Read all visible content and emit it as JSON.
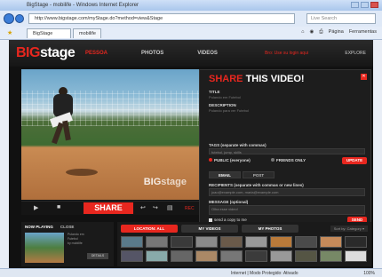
{
  "browser": {
    "title": "BigStage - mobilife - Windows Internet Explorer",
    "address": "http://www.bigstage.com/myStage.do?method=view&Stage",
    "search_placeholder": "Live Search",
    "tabs": [
      "BigStage",
      "mobilife"
    ],
    "tools": [
      "Página",
      "Ferramentas"
    ],
    "status_zone": "Internet | Modo Protegido: Ativado",
    "zoom": "100%"
  },
  "site": {
    "logo_big": "BIG",
    "logo_stage": "stage",
    "nav": [
      "PESSOA",
      "PHOTOS",
      "VIDEOS"
    ],
    "top_right": "Bro: Use su login aqui",
    "menu_label": "EXPLORE"
  },
  "video": {
    "watermark_big": "BIG",
    "watermark_stage": "stage"
  },
  "share": {
    "title_red": "SHARE",
    "title_rest": "THIS VIDEO!",
    "title_label": "TITLE",
    "title_value": "Pulando em Futebol",
    "desc_label": "DESCRIPTION",
    "desc_value": "Pulando para ver Futebol",
    "tags_label": "TAGS (separate with commas)",
    "tags_value": "futebol, jump, skills",
    "public_label": "PUBLIC (everyone)",
    "friends_label": "FRIENDS ONLY",
    "update_btn": "UPDATE",
    "tab_email": "EMAIL",
    "tab_post": "POST",
    "recipients_label": "RECIPIENTS (separate with commas or new lines)",
    "recipients_value": "joao@example.com, maria@example.com",
    "message_label": "MESSAGE (optional)",
    "message_value": "Olha esse video!",
    "copy_label": "send a copy to me",
    "send_btn": "SEND"
  },
  "controls": {
    "play": "▶",
    "stop": "■",
    "share": "SHARE",
    "back": "↩",
    "redo": "↪",
    "film": "▤",
    "rec": "REC"
  },
  "now_playing": {
    "label": "NOW PLAYING",
    "close": "CLOSE",
    "info1": "Pulando em",
    "info2": "Futebol",
    "info3": "by mobilife",
    "btn": "DETAILS"
  },
  "gallery": {
    "tabs": [
      "LOCATION: ALL",
      "MY VIDEOS",
      "MY PHOTOS"
    ],
    "sort": "Sort by: Category ▾",
    "colors": [
      "#5a7a8a",
      "#777",
      "#3a3a3a",
      "#8a8a8a",
      "#6a5a4a",
      "#999",
      "#b97a3a",
      "#4a4a4a",
      "#c58a5a",
      "#2a2a2a",
      "#556",
      "#8aa",
      "#666",
      "#a86",
      "#777",
      "#3b3b3b",
      "#999",
      "#554",
      "#786",
      "#ddd"
    ]
  }
}
